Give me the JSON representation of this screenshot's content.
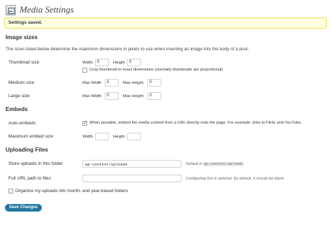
{
  "header": {
    "title": "Media Settings",
    "icon": "media-settings-icon"
  },
  "notice": {
    "text": "Settings saved."
  },
  "image_sizes": {
    "title": "Image sizes",
    "description": "The sizes listed below determine the maximum dimensions in pixels to use when inserting an image into the body of a post.",
    "thumbnail": {
      "label": "Thumbnail size",
      "width_label": "Width",
      "width_value": "0",
      "height_label": "Height",
      "height_value": "0",
      "crop_label": "Crop thumbnail to exact dimensions (normally thumbnails are proportional)",
      "crop_checked": false
    },
    "medium": {
      "label": "Medium size",
      "max_width_label": "Max Width",
      "max_width_value": "0",
      "max_height_label": "Max Height",
      "max_height_value": "0"
    },
    "large": {
      "label": "Large size",
      "max_width_label": "Max Width",
      "max_width_value": "0",
      "max_height_label": "Max Height",
      "max_height_value": "0"
    }
  },
  "embeds": {
    "title": "Embeds",
    "auto": {
      "label": "Auto-embeds",
      "checked": true,
      "text": "When possible, embed the media content from a URL directly onto the page. For example: links to Flickr and YouTube."
    },
    "max_size": {
      "label": "Maximum embed size",
      "width_label": "Width",
      "width_value": "",
      "height_label": "Height",
      "height_value": ""
    }
  },
  "uploading": {
    "title": "Uploading Files",
    "store": {
      "label": "Store uploads in this folder",
      "value": "wp-content/uploads",
      "hint_prefix": "Default is",
      "hint_code": "wp-content/uploads"
    },
    "full_url": {
      "label": "Full URL path to files",
      "value": "",
      "hint": "Configuring this is optional. By default, it should be blank."
    },
    "organize": {
      "label": "Organize my uploads into month- and year-based folders",
      "checked": false
    }
  },
  "save_button": "Save Changes",
  "colors": {
    "button": "#21759b",
    "notice_bg": "#ffffe0",
    "notice_border": "#e6db55"
  }
}
